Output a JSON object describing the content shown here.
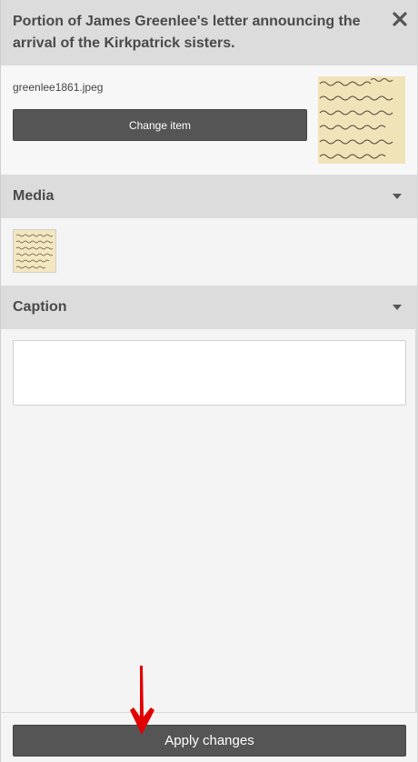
{
  "panel": {
    "title": "Portion of James Greenlee's letter announcing the arrival of the Kirkpatrick sisters.",
    "close_icon": "close-icon"
  },
  "item": {
    "filename": "greenlee1861.jpeg",
    "change_label": "Change item"
  },
  "media": {
    "heading": "Media"
  },
  "caption": {
    "heading": "Caption",
    "value": ""
  },
  "footer": {
    "apply_label": "Apply changes"
  },
  "annotation": {
    "arrow_color": "#e00000"
  }
}
